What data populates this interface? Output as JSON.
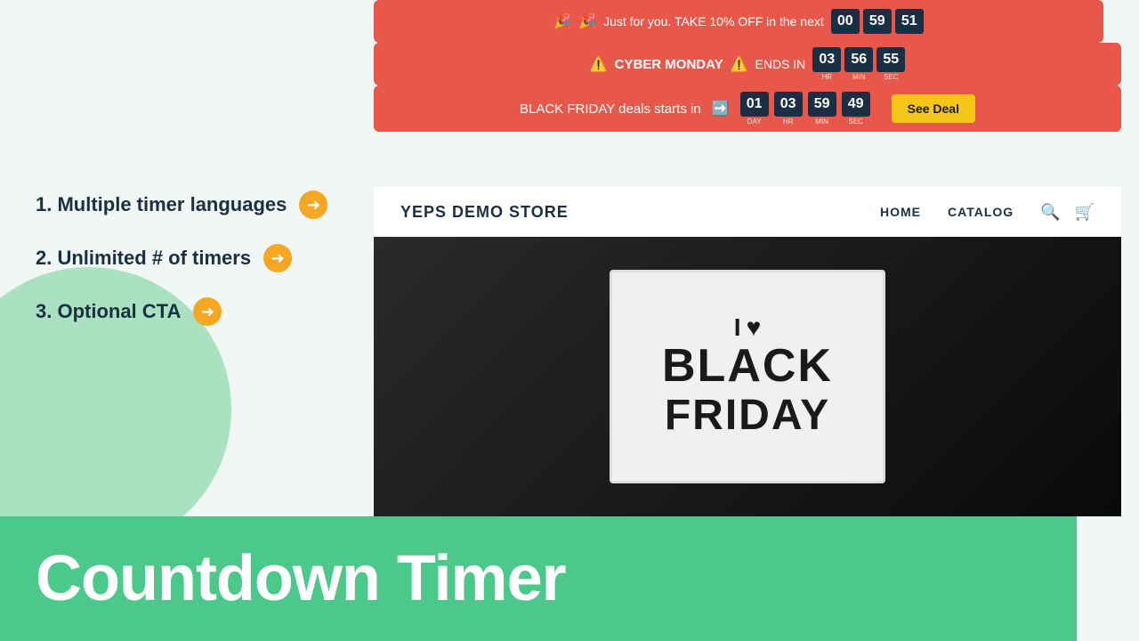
{
  "left": {
    "features": [
      {
        "id": "feature-1",
        "text": "1. Multiple timer languages"
      },
      {
        "id": "feature-2",
        "text": "2. Unlimited # of timers"
      },
      {
        "id": "feature-3",
        "text": "3. Optional CTA"
      }
    ],
    "arrow_symbol": "➔"
  },
  "bottom_bar": {
    "title": "Countdown Timer"
  },
  "demo": {
    "timer_bar_1": {
      "emoji_left": "🎉",
      "emoji_right": "🎉",
      "text": "Just for you. TAKE 10% OFF in the next",
      "digits": {
        "h": "00",
        "m": "59",
        "s": "51"
      }
    },
    "timer_bar_2": {
      "warning_left": "⚠️",
      "warning_right": "⚠️",
      "text": "CYBER MONDAY",
      "ends_in": "ENDS IN",
      "digits": {
        "hr": "03",
        "min": "56",
        "sec": "55"
      }
    },
    "timer_bar_3": {
      "text": "BLACK FRIDAY deals starts in",
      "arrow_emoji": "➡️",
      "digits": {
        "day": "01",
        "hr": "03",
        "min": "59",
        "sec": "49"
      },
      "cta_label": "See Deal"
    },
    "store": {
      "logo": "YEPS DEMO STORE",
      "nav_home": "HOME",
      "nav_catalog": "CATALOG"
    },
    "hero": {
      "line1_text": "I",
      "line1_heart": "♥",
      "line2": "BLACK",
      "line3": "FRIDAY"
    }
  }
}
